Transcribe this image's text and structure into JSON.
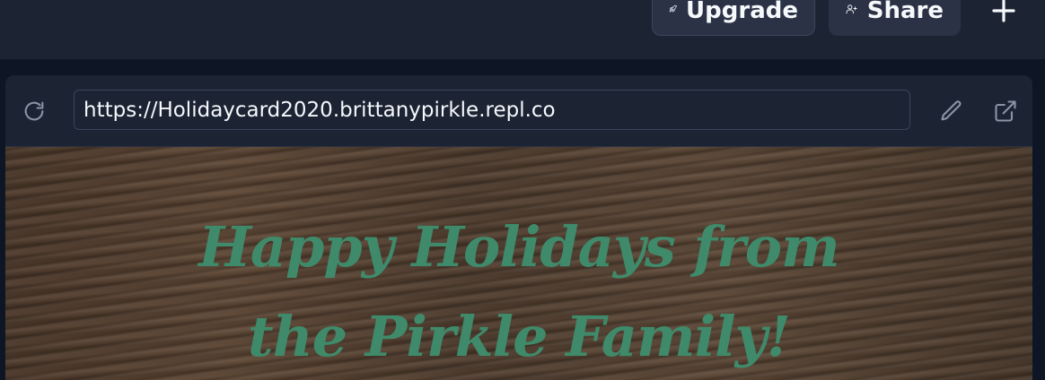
{
  "topbar": {
    "upgrade_label": "Upgrade",
    "upgrade_icon": "rocket-icon",
    "share_label": "Share",
    "share_icon": "user-plus-icon",
    "new_tab_icon": "plus-icon"
  },
  "webview": {
    "refresh_icon": "refresh-icon",
    "url": "https://Holidaycard2020.brittanypirkle.repl.co",
    "edit_icon": "pencil-icon",
    "open_external_icon": "external-link-icon"
  },
  "page": {
    "headline_line1": "Happy Holidays from",
    "headline_line2": "the Pirkle Family!"
  },
  "colors": {
    "app_background": "#0e1525",
    "panel": "#1c2333",
    "button": "#2b3245",
    "text": "#f5f9fc",
    "headline": "#3f8a6a",
    "wood": "#4f3b2d"
  }
}
